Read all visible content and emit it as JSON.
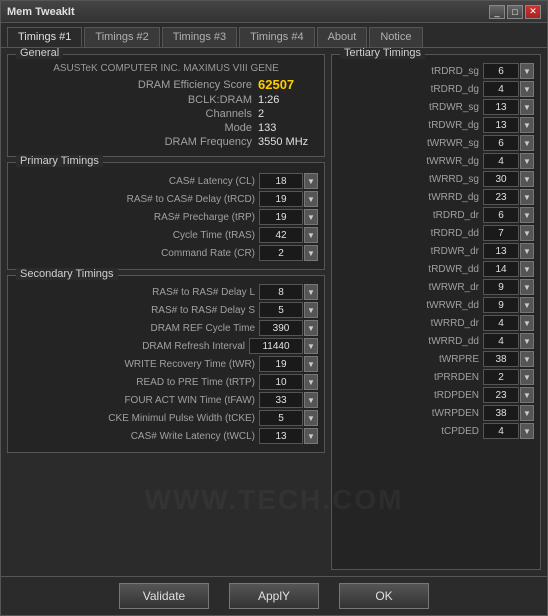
{
  "window": {
    "title": "Mem TweakIt",
    "controls": [
      "_",
      "□",
      "✕"
    ]
  },
  "tabs": [
    {
      "label": "Timings #1",
      "active": true
    },
    {
      "label": "Timings #2",
      "active": false
    },
    {
      "label": "Timings #3",
      "active": false
    },
    {
      "label": "Timings #4",
      "active": false
    },
    {
      "label": "About",
      "active": false
    },
    {
      "label": "Notice",
      "active": false
    }
  ],
  "general": {
    "mobo": "ASUSTeK COMPUTER INC. MAXIMUS VIII GENE",
    "dram_efficiency_label": "DRAM Efficiency Score",
    "dram_efficiency_value": "62507",
    "bclk_label": "BCLK:DRAM",
    "bclk_value": "1:26",
    "channels_label": "Channels",
    "channels_value": "2",
    "mode_label": "Mode",
    "mode_value": "133",
    "freq_label": "DRAM Frequency",
    "freq_value": "3550 MHz"
  },
  "primary_timings": {
    "group_label": "Primary Timings",
    "rows": [
      {
        "label": "CAS# Latency (CL)",
        "value": "18"
      },
      {
        "label": "RAS# to CAS# Delay (tRCD)",
        "value": "19"
      },
      {
        "label": "RAS# Precharge (tRP)",
        "value": "19"
      },
      {
        "label": "Cycle Time (tRAS)",
        "value": "42"
      },
      {
        "label": "Command Rate (CR)",
        "value": "2"
      }
    ]
  },
  "secondary_timings": {
    "group_label": "Secondary Timings",
    "rows": [
      {
        "label": "RAS# to RAS# Delay L",
        "value": "8"
      },
      {
        "label": "RAS# to RAS# Delay S",
        "value": "5"
      },
      {
        "label": "DRAM REF Cycle Time",
        "value": "390"
      },
      {
        "label": "DRAM Refresh Interval",
        "value": "11440"
      },
      {
        "label": "WRITE Recovery Time (tWR)",
        "value": "19"
      },
      {
        "label": "READ to PRE Time (tRTP)",
        "value": "10"
      },
      {
        "label": "FOUR ACT WIN Time (tFAW)",
        "value": "33"
      },
      {
        "label": "CKE Minimul Pulse Width (tCKE)",
        "value": "5"
      },
      {
        "label": "CAS# Write Latency (tWCL)",
        "value": "13"
      }
    ]
  },
  "tertiary_timings": {
    "group_label": "Tertiary Timings",
    "rows": [
      {
        "label": "tRDRD_sg",
        "value": "6"
      },
      {
        "label": "tRDRD_dg",
        "value": "4"
      },
      {
        "label": "tRDWR_sg",
        "value": "13"
      },
      {
        "label": "tRDWR_dg",
        "value": "13"
      },
      {
        "label": "tWRWR_sg",
        "value": "6"
      },
      {
        "label": "tWRWR_dg",
        "value": "4"
      },
      {
        "label": "tWRRD_sg",
        "value": "30"
      },
      {
        "label": "tWRRD_dg",
        "value": "23"
      },
      {
        "label": "tRDRD_dr",
        "value": "6"
      },
      {
        "label": "tRDRD_dd",
        "value": "7"
      },
      {
        "label": "tRDWR_dr",
        "value": "13"
      },
      {
        "label": "tRDWR_dd",
        "value": "14"
      },
      {
        "label": "tWRWR_dr",
        "value": "9"
      },
      {
        "label": "tWRWR_dd",
        "value": "9"
      },
      {
        "label": "tWRRD_dr",
        "value": "4"
      },
      {
        "label": "tWRRD_dd",
        "value": "4"
      },
      {
        "label": "tWRPRE",
        "value": "38"
      },
      {
        "label": "tPRRDEN",
        "value": "2"
      },
      {
        "label": "tRDPDEN",
        "value": "23"
      },
      {
        "label": "tWRPDEN",
        "value": "38"
      },
      {
        "label": "tCPDED",
        "value": "4"
      }
    ]
  },
  "footer": {
    "validate_label": "Validate",
    "apply_label": "ApplY",
    "ok_label": "OK"
  }
}
